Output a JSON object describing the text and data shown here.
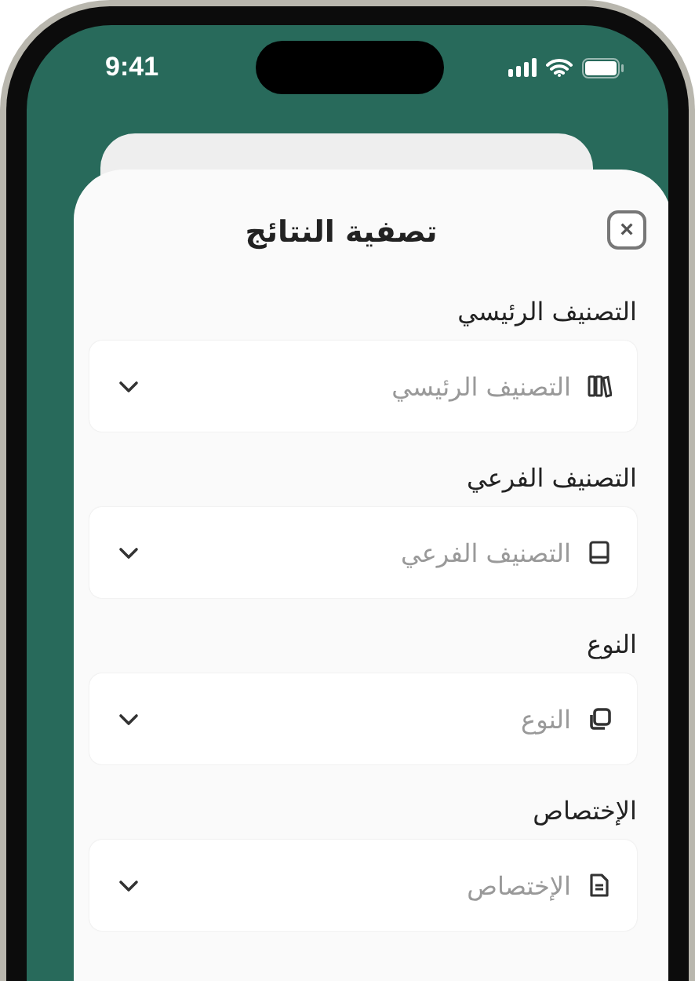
{
  "status_bar": {
    "time": "9:41"
  },
  "sheet": {
    "title": "تصفية النتائج",
    "close_label": "×"
  },
  "fields": [
    {
      "label": "التصنيف الرئيسي",
      "placeholder": "التصنيف الرئيسي"
    },
    {
      "label": "التصنيف الفرعي",
      "placeholder": "التصنيف الفرعي"
    },
    {
      "label": "النوع",
      "placeholder": "النوع"
    },
    {
      "label": "الإختصاص",
      "placeholder": "الإختصاص"
    }
  ]
}
